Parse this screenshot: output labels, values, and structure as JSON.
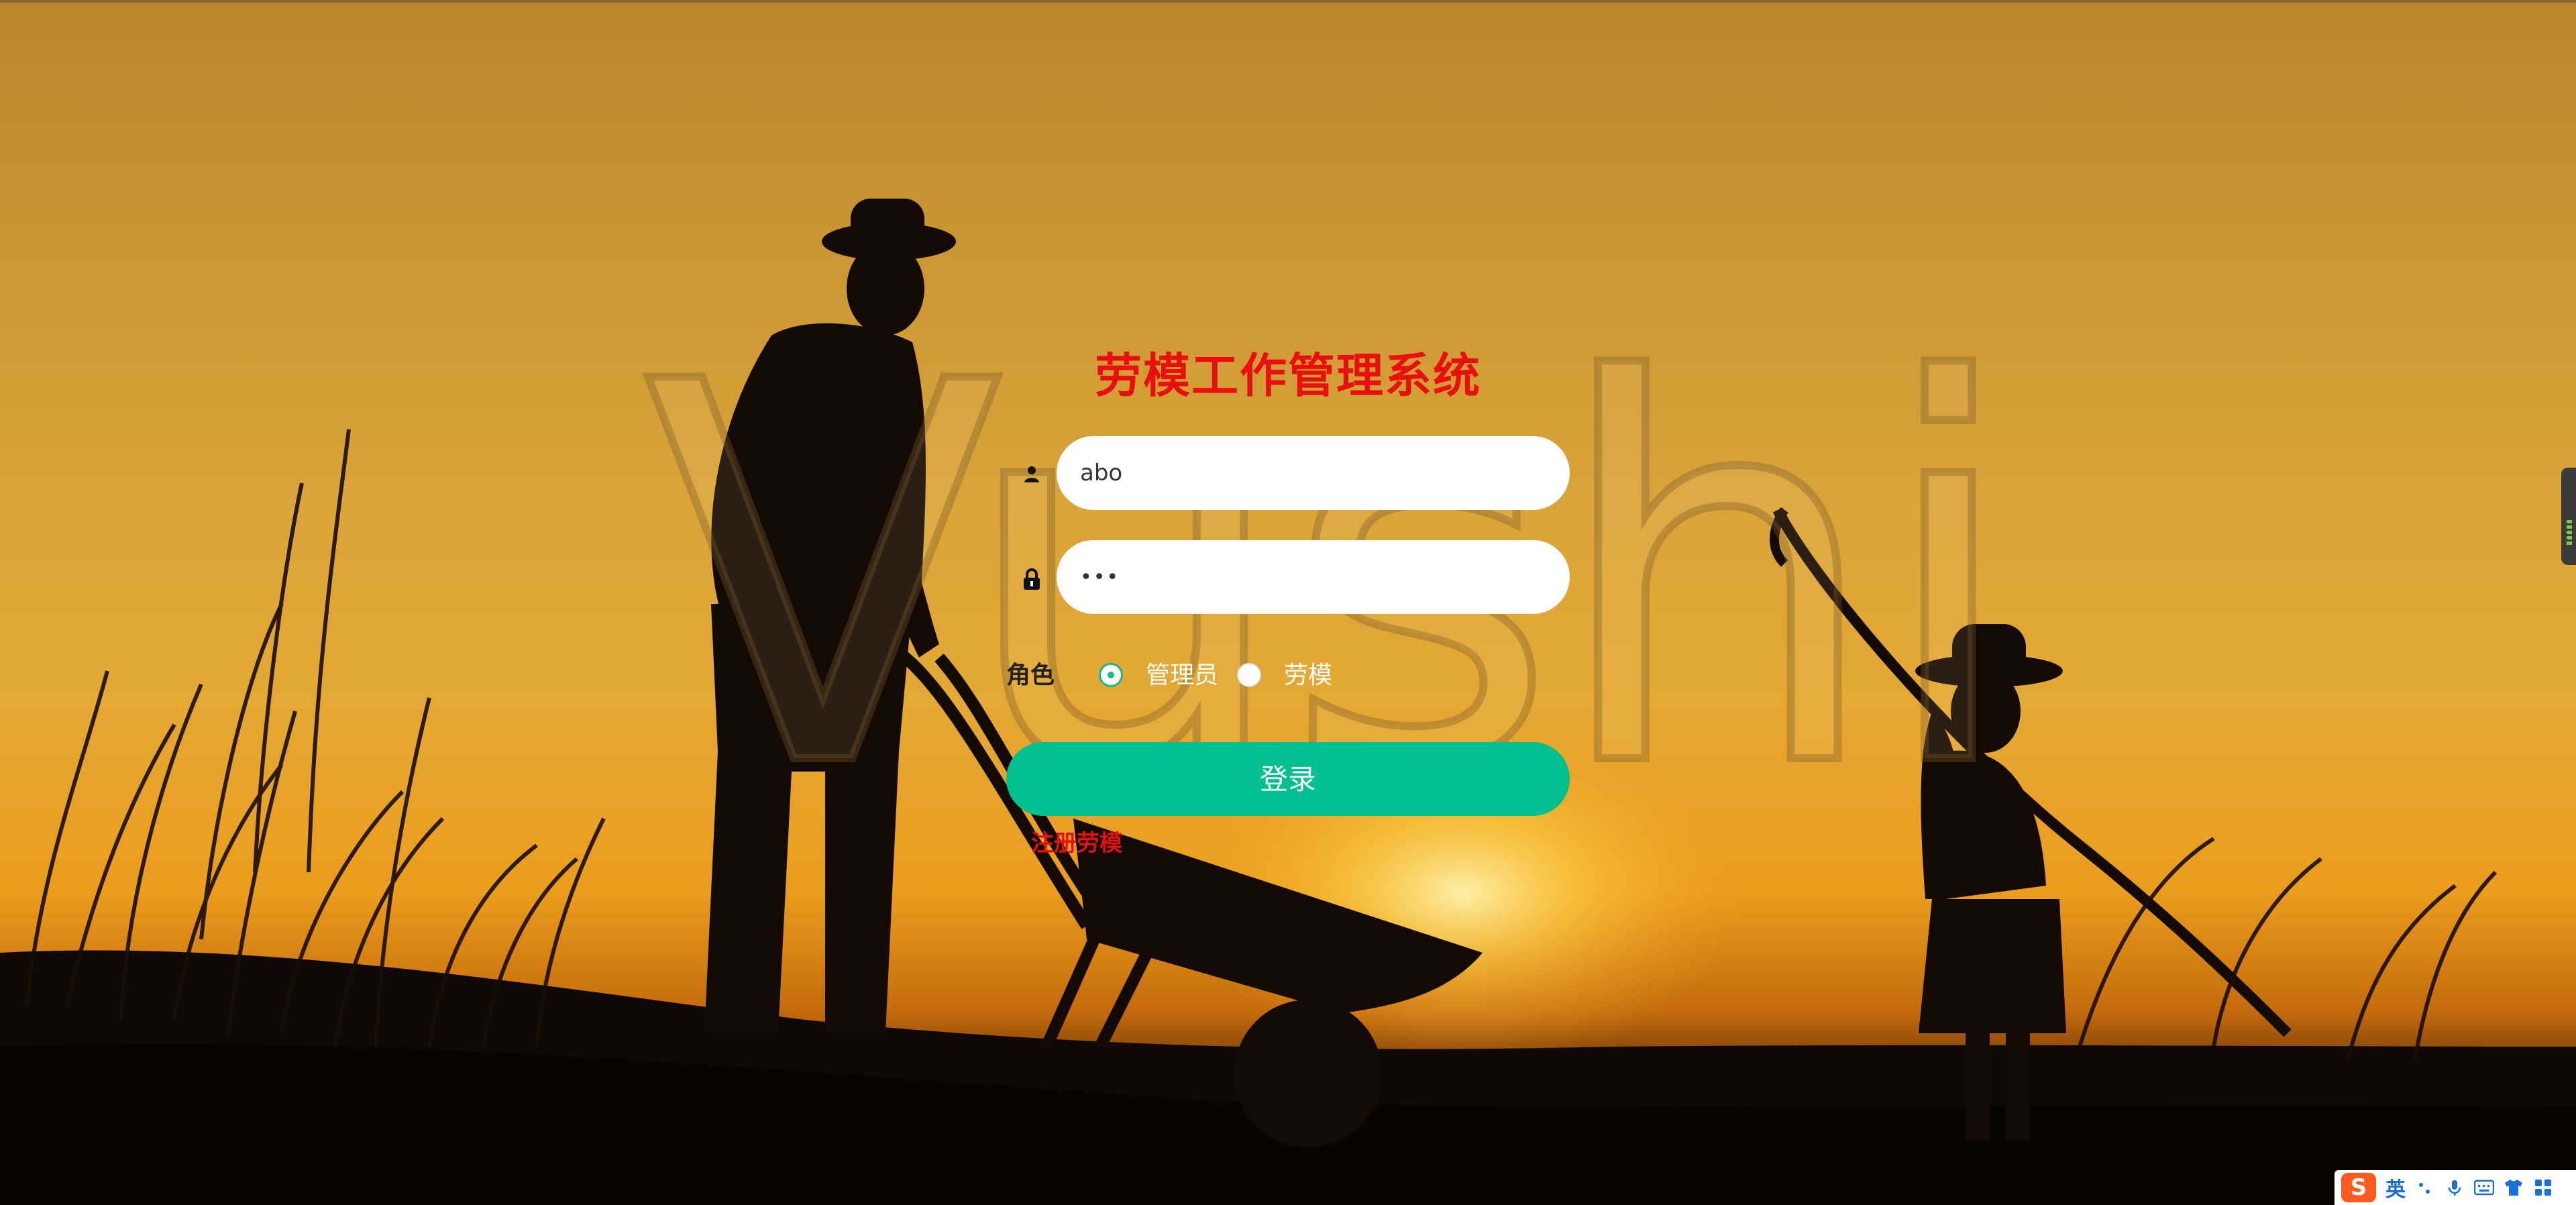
{
  "app": {
    "title": "劳模工作管理系统",
    "watermark": "Vushi"
  },
  "login": {
    "username": {
      "value": "abo",
      "icon": "user-icon"
    },
    "password": {
      "value": "•••",
      "icon": "lock-icon"
    },
    "role": {
      "label": "角色",
      "options": [
        {
          "label": "管理员",
          "checked": true
        },
        {
          "label": "劳模",
          "checked": false
        }
      ]
    },
    "submit_label": "登录",
    "register_label": "注册劳模"
  },
  "ime": {
    "logo": "S",
    "mode": "英",
    "icons": [
      "punctuation-icon",
      "microphone-icon",
      "keyboard-icon",
      "skin-icon",
      "menu-grid-icon"
    ]
  },
  "colors": {
    "title": "#e8100e",
    "accent": "#00c08f",
    "radio_accent": "#19b88a",
    "link": "#e8100e"
  }
}
